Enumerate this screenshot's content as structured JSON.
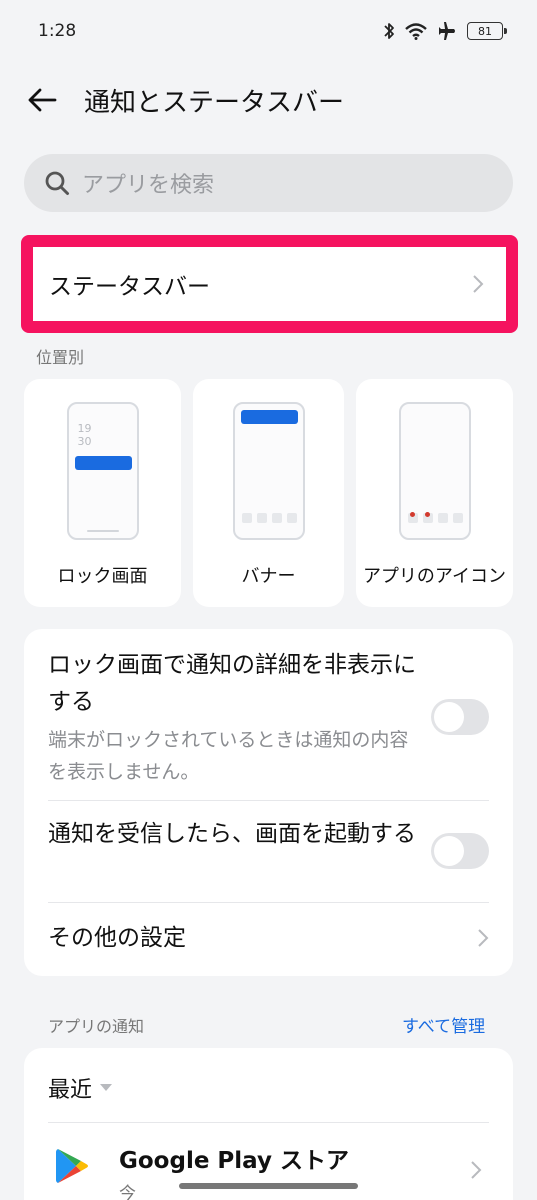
{
  "status_bar": {
    "time": "1:28",
    "battery": "81"
  },
  "header": {
    "title": "通知とステータスバー"
  },
  "search": {
    "placeholder": "アプリを検索"
  },
  "status_bar_row": {
    "label": "ステータスバー"
  },
  "position_section": {
    "label": "位置別",
    "cards": [
      {
        "label": "ロック画面",
        "clock_hour": "19",
        "clock_min": "30"
      },
      {
        "label": "バナー"
      },
      {
        "label": "アプリのアイコン"
      }
    ]
  },
  "settings": {
    "lock_hide": {
      "title": "ロック画面で通知の詳細を非表示にする",
      "desc": "端末がロックされているときは通知の内容を表示しません。",
      "enabled": false
    },
    "wake_screen": {
      "title": "通知を受信したら、画面を起動する",
      "enabled": false
    },
    "other": {
      "label": "その他の設定"
    }
  },
  "app_notifications": {
    "label": "アプリの通知",
    "manage_all": "すべて管理",
    "sort": "最近",
    "apps": [
      {
        "name": "Google Play ストア",
        "time": "今"
      }
    ]
  },
  "colors": {
    "accent": "#1a6be0",
    "highlight": "#f5135f"
  }
}
